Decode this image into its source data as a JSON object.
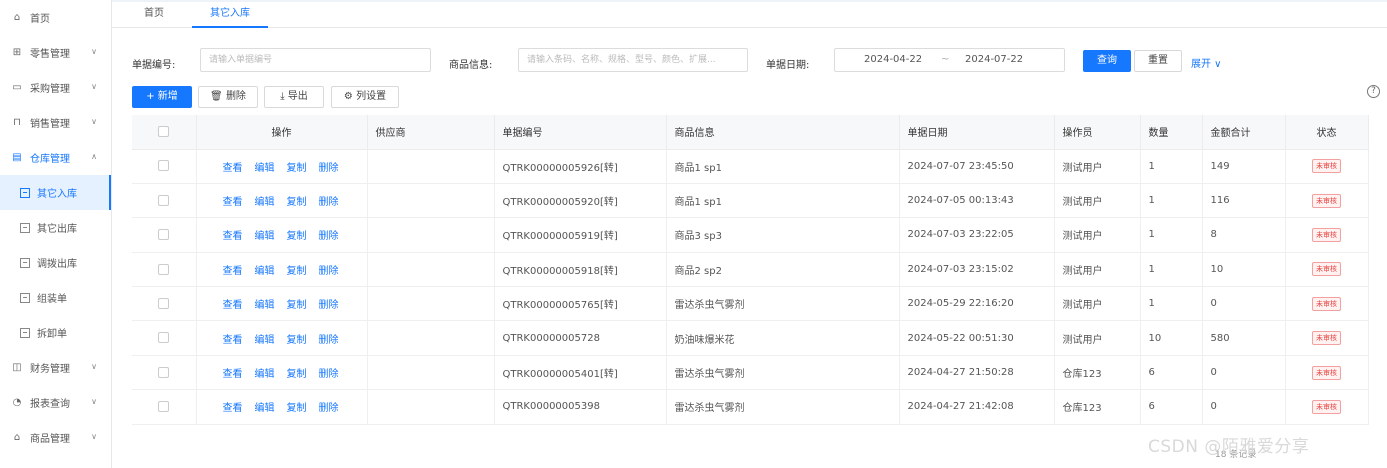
{
  "sidebar": {
    "items": [
      {
        "label": "首页",
        "icon": "home-icon",
        "glyph": "⌂"
      },
      {
        "label": "零售管理",
        "icon": "store-icon",
        "glyph": "⊞"
      },
      {
        "label": "采购管理",
        "icon": "cart-icon",
        "glyph": "▭"
      },
      {
        "label": "销售管理",
        "icon": "cart-sale-icon",
        "glyph": "⊓"
      },
      {
        "label": "仓库管理",
        "icon": "warehouse-icon",
        "glyph": "▤"
      },
      {
        "label": "其它入库"
      },
      {
        "label": "其它出库"
      },
      {
        "label": "调拨出库"
      },
      {
        "label": "组装单"
      },
      {
        "label": "拆卸单"
      },
      {
        "label": "财务管理",
        "icon": "finance-icon",
        "glyph": "◫"
      },
      {
        "label": "报表查询",
        "icon": "report-icon",
        "glyph": "◔"
      },
      {
        "label": "商品管理",
        "icon": "goods-icon",
        "glyph": "⌂"
      }
    ]
  },
  "tabs": {
    "home": "首页",
    "current": "其它入库"
  },
  "filters": {
    "bill_no_label": "单据编号:",
    "bill_no_placeholder": "请输入单据编号",
    "goods_label": "商品信息:",
    "goods_placeholder": "请输入条码、名称、规格、型号、颜色、扩展...",
    "date_label": "单据日期:",
    "date_start": "2024-04-22",
    "date_sep": "~",
    "date_end": "2024-07-22",
    "query_btn": "查询",
    "reset_btn": "重置",
    "expand_link": "展开 ∨"
  },
  "toolbar": {
    "add": "+ 新增",
    "delete": "删除",
    "export": "导出",
    "columns": "列设置"
  },
  "table": {
    "headers": [
      "操作",
      "供应商",
      "单据编号",
      "商品信息",
      "单据日期",
      "操作员",
      "数量",
      "金额合计",
      "状态"
    ],
    "actions": [
      "查看",
      "编辑",
      "复制",
      "删除"
    ],
    "rows": [
      {
        "bill_no": "QTRK00000005926[转]",
        "goods": "商品1 sp1",
        "date": "2024-07-07 23:45:50",
        "operator": "测试用户",
        "qty": "1",
        "amount": "149",
        "status": "未审核"
      },
      {
        "bill_no": "QTRK00000005920[转]",
        "goods": "商品1 sp1",
        "date": "2024-07-05 00:13:43",
        "operator": "测试用户",
        "qty": "1",
        "amount": "116",
        "status": "未审核"
      },
      {
        "bill_no": "QTRK00000005919[转]",
        "goods": "商品3 sp3",
        "date": "2024-07-03 23:22:05",
        "operator": "测试用户",
        "qty": "1",
        "amount": "8",
        "status": "未审核"
      },
      {
        "bill_no": "QTRK00000005918[转]",
        "goods": "商品2 sp2",
        "date": "2024-07-03 23:15:02",
        "operator": "测试用户",
        "qty": "1",
        "amount": "10",
        "status": "未审核"
      },
      {
        "bill_no": "QTRK00000005765[转]",
        "goods": "雷达杀虫气雾剂",
        "date": "2024-05-29 22:16:20",
        "operator": "测试用户",
        "qty": "1",
        "amount": "0",
        "status": "未审核"
      },
      {
        "bill_no": "QTRK00000005728",
        "goods": "奶油味爆米花",
        "date": "2024-05-22 00:51:30",
        "operator": "测试用户",
        "qty": "10",
        "amount": "580",
        "status": "未审核"
      },
      {
        "bill_no": "QTRK00000005401[转]",
        "goods": "雷达杀虫气雾剂",
        "date": "2024-04-27 21:50:28",
        "operator": "仓库123",
        "qty": "6",
        "amount": "0",
        "status": "未审核"
      },
      {
        "bill_no": "QTRK00000005398",
        "goods": "雷达杀虫气雾剂",
        "date": "2024-04-27 21:42:08",
        "operator": "仓库123",
        "qty": "6",
        "amount": "0",
        "status": "未审核"
      }
    ]
  },
  "help_glyph": "?",
  "watermark": "CSDN @陌雅爱分享",
  "pager_fragment": "18 条记录"
}
